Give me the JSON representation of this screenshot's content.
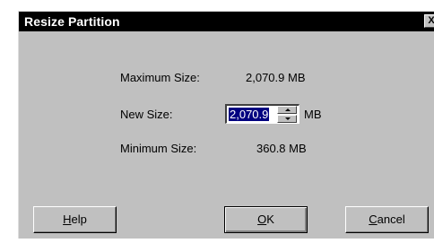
{
  "window": {
    "title": "Resize Partition",
    "close_glyph": "X"
  },
  "fields": {
    "maximum_label": "Maximum Size:",
    "maximum_value": "2,070.9 MB",
    "new_label": "New Size:",
    "new_value": "2,070.9",
    "new_unit": "MB",
    "minimum_label": "Minimum Size:",
    "minimum_value": "360.8 MB"
  },
  "buttons": {
    "help_first": "H",
    "help_rest": "elp",
    "ok_first": "O",
    "ok_rest": "K",
    "cancel_first": "C",
    "cancel_rest": "ancel"
  },
  "colors": {
    "titlebar": "#000000",
    "dialog_bg": "#c0c0c0",
    "selection": "#000080"
  }
}
